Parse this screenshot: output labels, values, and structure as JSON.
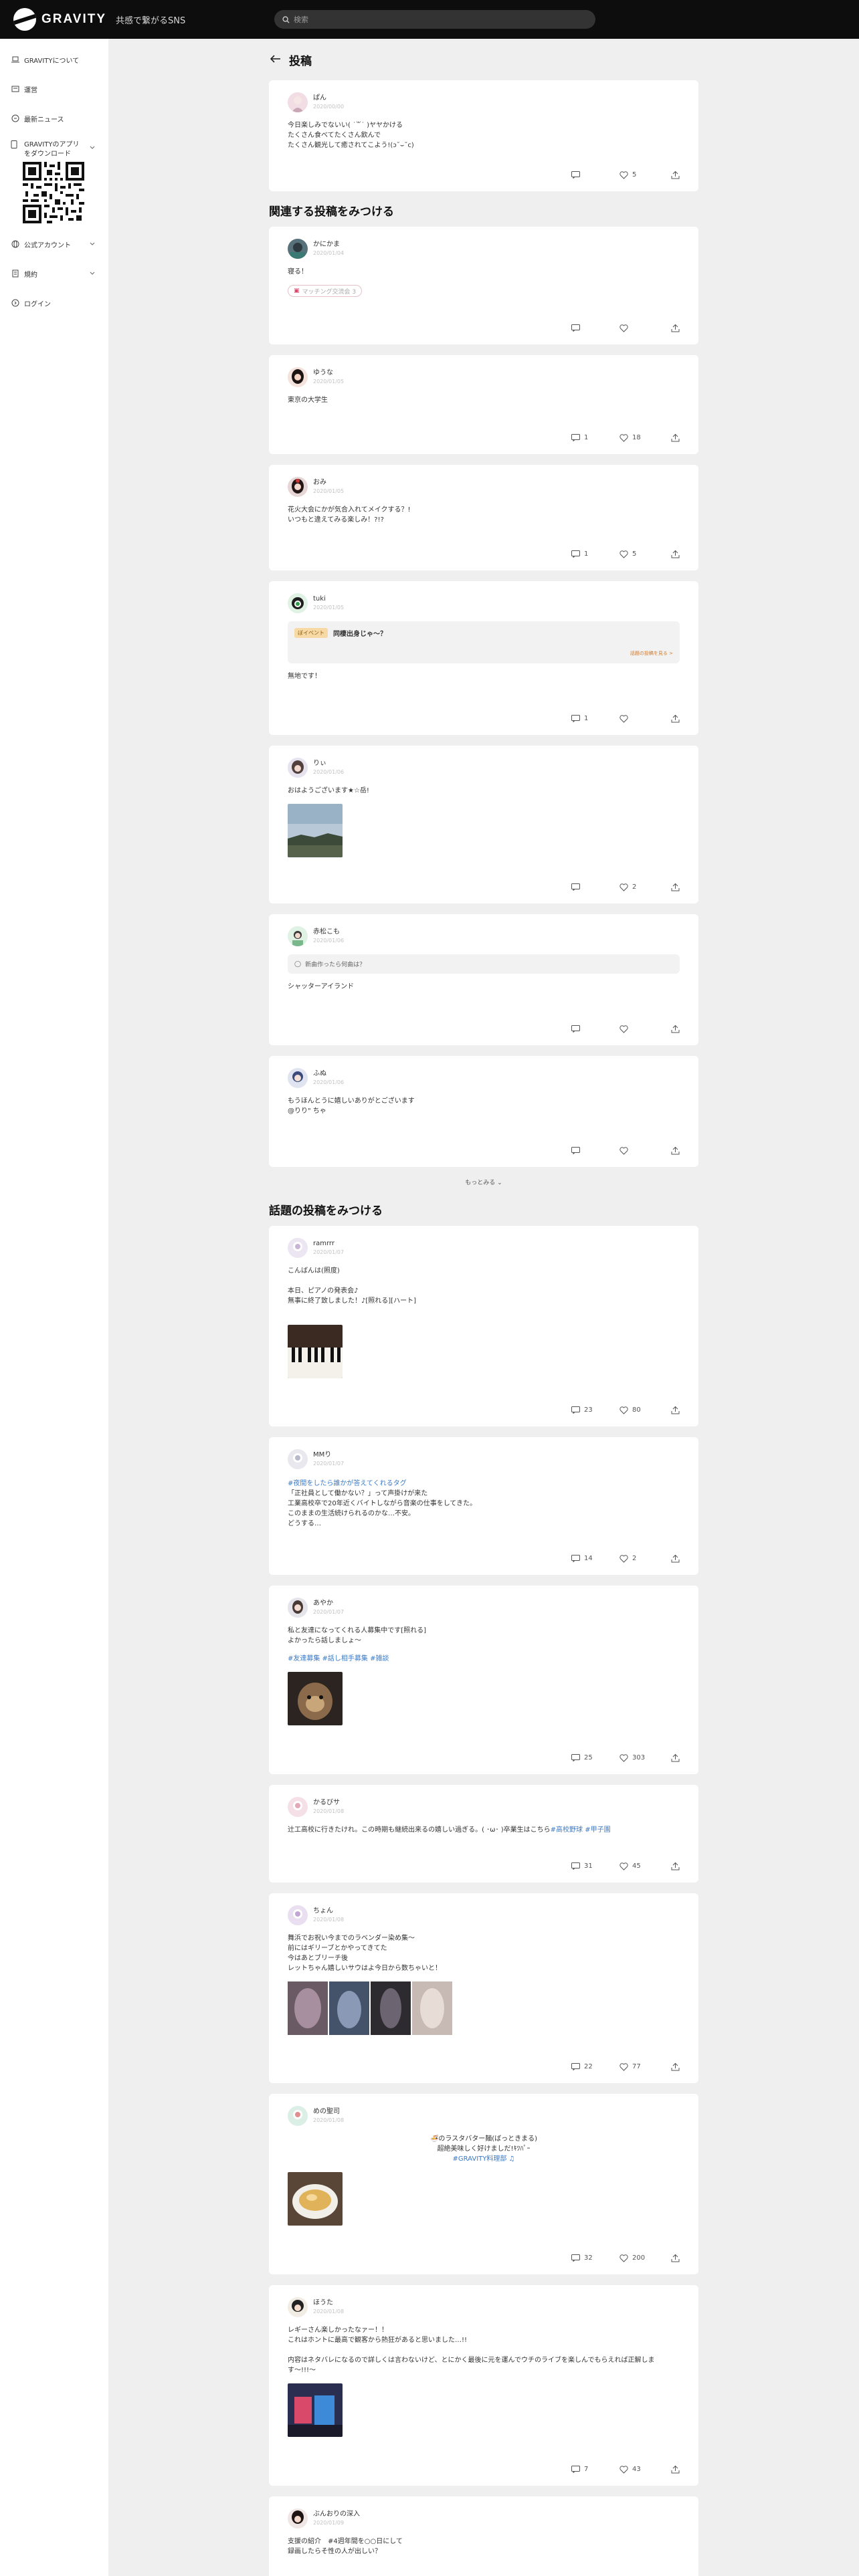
{
  "header": {
    "brand": "GRAVITY",
    "tagline": "共感で繋がるSNS",
    "search_placeholder": "検索"
  },
  "sidebar": {
    "items": [
      {
        "label": "GRAVITYについて",
        "icon": "laptop-icon"
      },
      {
        "label": "運営",
        "icon": "card-icon"
      },
      {
        "label": "最新ニュース",
        "icon": "news-icon"
      }
    ],
    "app": {
      "label_line1": "GRAVITYのアプリ",
      "label_line2": "をダウンロード"
    },
    "items2": [
      {
        "label": "公式アカウント",
        "icon": "globe-icon"
      },
      {
        "label": "規約",
        "icon": "document-icon"
      },
      {
        "label": "ログイン",
        "icon": "login-icon"
      }
    ]
  },
  "page": {
    "title": "投稿",
    "related_title": "関連する投稿をみつける",
    "trending_title": "話題の投稿をみつける",
    "more_label": "もっとみる"
  },
  "main_post": {
    "name": "ぱん",
    "date": "2020/00/00",
    "body": "今日楽しみでないい( ˙꒳˙ )ヤヤかける\nたくさん食べてたくさん飲んで\nたくさん観光して癒されてこよう!(ɔ˘⌣˘c)",
    "comments": "",
    "likes": "5"
  },
  "related": [
    {
      "name": "かにかま",
      "date": "2020/01/04",
      "body": "寝る！",
      "chip": "マッチング交流会 3",
      "comments": "",
      "likes": ""
    },
    {
      "name": "ゆうな",
      "date": "2020/01/05",
      "body": "東京の大学生",
      "comments": "1",
      "likes": "18"
    },
    {
      "name": "おみ",
      "date": "2020/01/05",
      "body": "花火大会にかが気合入れてメイクする？!\nいつもと違えてみる楽しみ！?!?",
      "comments": "1",
      "likes": "5"
    },
    {
      "name": "tuki",
      "date": "2020/01/05",
      "badge": "ぼイベント",
      "quote": "同棲出身じゃ〜？",
      "quote_foot": "話題の投稿を見る >",
      "body": "無地です！",
      "comments": "1",
      "likes": ""
    },
    {
      "name": "りぃ",
      "date": "2020/01/06",
      "body": "おはようございます★☆岳!",
      "comments": "",
      "likes": "2"
    },
    {
      "name": "赤松こも",
      "date": "2020/01/06",
      "poll": "新曲作ったら何曲は？",
      "body": "シャッターアイランド",
      "comments": "",
      "likes": ""
    },
    {
      "name": "ふぬ",
      "date": "2020/01/06",
      "body": "もうほんとうに嬉しいありがとございます\n@りり\" ちゃ",
      "comments": "",
      "likes": ""
    }
  ],
  "trending": [
    {
      "name": "ramrrr",
      "date": "2020/01/07",
      "body": "こんばんは(照度)\n\n本日、ピアノの発表会♪\n無事に終了致しました！♪[照れる][ハート]",
      "comments": "23",
      "likes": "80"
    },
    {
      "name": "MMり",
      "date": "2020/01/07",
      "hashtags": "#夜間をしたら誰かが答えてくれるタグ",
      "body": "「正社員として働かない？」って声掛けが来た\n工業高校卒で20年近くバイトしながら音楽の仕事をしてきた。\nこのままの生活続けられるのかな…不安。\nどうする…",
      "comments": "14",
      "likes": "2"
    },
    {
      "name": "あやか",
      "date": "2020/01/07",
      "body": "私と友達になってくれる人募集中です[照れる]\nよかったら話しましょ〜",
      "hashtags": "#友達募集 #話し相手募集 #雑談",
      "comments": "25",
      "likes": "303"
    },
    {
      "name": "かるびサ",
      "date": "2020/01/08",
      "body": "辻工高校に行きたけれ。この時期も継続出来るの嬉しい過ぎる。( ･ω･ )卒業生はこちら",
      "hashtags": "#高校野球 #甲子園",
      "comments": "31",
      "likes": "45"
    },
    {
      "name": "ちょん",
      "date": "2020/01/08",
      "body": "舞浜でお祝い今までのラベンダー染め集〜\n前にはギリーブとかやってきてた\n今はあとブリーチ後\nレットちゃん嬉しいサウはよ今日から数ちゃいと！",
      "comments": "22",
      "likes": "77"
    },
    {
      "name": "めの聖司",
      "date": "2020/01/08",
      "body": "🍜のラスタバター麺(ばっときまる)\n超絶美味しく好けましだ!ｷﾂﾊﾟｰ",
      "hashtags": "#GRAVITY料理部 ♫",
      "comments": "32",
      "likes": "200"
    },
    {
      "name": "ほうた",
      "date": "2020/01/08",
      "body": "レギーさん楽しかったなァー！！\nこれはホントに最高で観客から熱狂があると思いました…!!\n\n内容はネタバレになるので詳しくは言わないけど、とにかく最後に元を運んでウチのライブを楽しんでもらえれば正解します〜!!!〜",
      "comments": "7",
      "likes": "43"
    },
    {
      "name": "ぶんおりの深入",
      "date": "2020/01/09",
      "body": "支援の紹介　#4週年間を○○日にして\n録画したらそ性の人が出しい？",
      "comments": "",
      "likes": ""
    }
  ]
}
